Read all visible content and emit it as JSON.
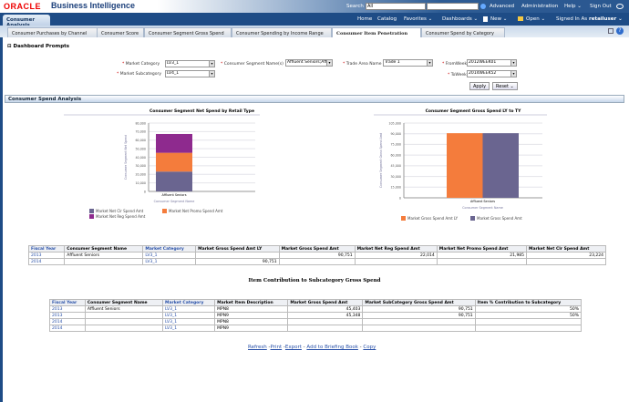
{
  "header": {
    "logo": "ORACLE",
    "title": "Business Intelligence",
    "search_label": "Search",
    "search_scope": "All",
    "search_value": "",
    "advanced": "Advanced",
    "administration": "Administration",
    "help": "Help ⌄",
    "sign_out": "Sign Out"
  },
  "nav": {
    "dashboard_tab": "Consumer Analysis",
    "home": "Home",
    "catalog": "Catalog",
    "favorites": "Favorites ⌄",
    "dashboards": "Dashboards ⌄",
    "new": "New ⌄",
    "open": "Open ⌄",
    "signed_in_as": "Signed In As",
    "user": "retailuser ⌄"
  },
  "page_tabs": [
    {
      "label": "Consumer Purchases by Channel"
    },
    {
      "label": "Consumer Score"
    },
    {
      "label": "Consumer Segment Gross Spend"
    },
    {
      "label": "Consumer Spending by Income Range"
    },
    {
      "label": "Consumer Item Penetration",
      "active": true
    },
    {
      "label": "Consumer Spend by Category"
    }
  ],
  "prompts": {
    "title": "Dashboard Prompts",
    "fields": [
      {
        "label": "Market Category",
        "value": "LV3_1"
      },
      {
        "label": "Consumer Segment Name(s)",
        "value": "Affluent Seniors;Aff"
      },
      {
        "label": "Trade Area Name",
        "value": "Trade 1"
      },
      {
        "label": "FromWeek",
        "value": "2012WEEK01"
      },
      {
        "label": "Market Subcategory",
        "value": "LV4_1"
      },
      {
        "label": "ToWeek",
        "value": "2014WEEK52"
      }
    ],
    "apply": "Apply",
    "reset": "Reset ⌄"
  },
  "section_title": "Consumer Spend Analysis",
  "chart_data": [
    {
      "type": "bar",
      "stacked": true,
      "title": "Consumer Segment Net Spend by Retail Type",
      "xlabel": "Consumer Segment Name",
      "ylabel": "Consumer Segment Net Spend",
      "ylim": [
        0,
        80000
      ],
      "yticks": [
        "0",
        "10,000",
        "20,000",
        "30,000",
        "40,000",
        "50,000",
        "60,000",
        "70,000",
        "80,000"
      ],
      "categories": [
        "Affluent Seniors"
      ],
      "grid": true,
      "legend": "bottom",
      "series": [
        {
          "name": "Market Net Clr Spend Amt",
          "values": [
            23224
          ],
          "color": "#6a6590"
        },
        {
          "name": "Market Net Promo Spend Amt",
          "values": [
            21985
          ],
          "color": "#f47c3c"
        },
        {
          "name": "Market Net Reg Spend Amt",
          "values": [
            22014
          ],
          "color": "#8e2a8e"
        }
      ]
    },
    {
      "type": "bar",
      "title": "Consumer Segment Gross Spend LY to TY",
      "xlabel": "Consumer Segment Name",
      "ylabel": "Consumer Segment Gross Spend Amt",
      "ylim": [
        0,
        105000
      ],
      "yticks": [
        "0",
        "15,000",
        "30,000",
        "45,000",
        "60,000",
        "75,000",
        "90,000",
        "105,000"
      ],
      "categories": [
        "Affluent Seniors"
      ],
      "grid": true,
      "legend": "bottom",
      "series": [
        {
          "name": "Market Gross Spend Amt LY",
          "values": [
            90751
          ],
          "color": "#f47c3c"
        },
        {
          "name": "Market Gross Spend Amt",
          "values": [
            90751
          ],
          "color": "#6a6590"
        }
      ]
    }
  ],
  "table1": {
    "headers": [
      "Fiscal Year",
      "Consumer Segment Name",
      "Market Category",
      "Market Gross Spend Amt LY",
      "Market Gross Spend Amt",
      "Market Net Reg Spend Amt",
      "Market Net Promo Spend Amt",
      "Market Net Clr Spend Amt"
    ],
    "rows": [
      [
        "2013",
        "Affluent Seniors",
        "LV3_1",
        "",
        "90,751",
        "22,014",
        "21,985",
        "23,224"
      ],
      [
        "2014",
        "",
        "LV3_1",
        "90,751",
        "",
        "",
        "",
        ""
      ]
    ]
  },
  "table2": {
    "title": "Item Contribution to Subcategory Gross Spend",
    "headers": [
      "Fiscal Year",
      "Consumer Segment Name",
      "Market Category",
      "Market Item Description",
      "Market Gross Spend Amt",
      "Market SubCategory Gross Spend Amt",
      "Item % Contribution to Subcategory"
    ],
    "rows": [
      [
        "2013",
        "Affluent Seniors",
        "LV3_1",
        "MPN8",
        "45,403",
        "90,751",
        "50%"
      ],
      [
        "2013",
        "",
        "LV3_1",
        "MPN9",
        "45,348",
        "90,751",
        "50%"
      ],
      [
        "2014",
        "",
        "LV3_1",
        "MPN8",
        "",
        "",
        ""
      ],
      [
        "2014",
        "",
        "LV3_1",
        "MPN9",
        "",
        "",
        ""
      ]
    ]
  },
  "links": {
    "refresh": "Refresh",
    "print": "Print",
    "export": "Export",
    "briefing": "Add to Briefing Book",
    "copy": "Copy"
  }
}
